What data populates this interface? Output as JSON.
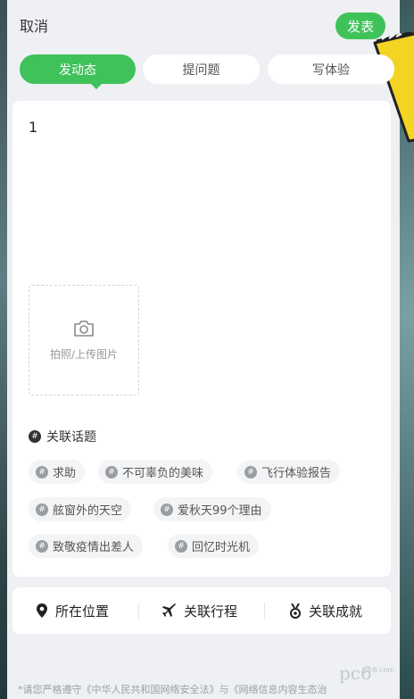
{
  "header": {
    "cancel_label": "取消",
    "publish_label": "发表"
  },
  "tabs": [
    {
      "label": "发动态",
      "active": true
    },
    {
      "label": "提问题",
      "active": false
    },
    {
      "label": "写体验",
      "active": false
    }
  ],
  "editor": {
    "text": "1"
  },
  "upload": {
    "label": "拍照/上传图片",
    "icon": "camera-icon"
  },
  "topics": {
    "heading": "关联话题",
    "items": [
      {
        "label": "求助"
      },
      {
        "label": "不可辜负的美味"
      },
      {
        "label": "飞行体验报告"
      },
      {
        "label": "舷窗外的天空"
      },
      {
        "label": "爱秋天99个理由"
      },
      {
        "label": "致敬疫情出差人"
      },
      {
        "label": "回忆时光机"
      }
    ]
  },
  "bottom_bar": [
    {
      "label": "所在位置",
      "icon": "location-pin-icon"
    },
    {
      "label": "关联行程",
      "icon": "airplane-icon"
    },
    {
      "label": "关联成就",
      "icon": "medal-icon"
    }
  ],
  "notice": "*请您严格遵守《中华人民共和国网络安全法》与《网络信息内容生态治",
  "watermark": {
    "text": "pc6",
    "sub": "pc6.com"
  },
  "colors": {
    "accent": "#3fc25a",
    "background": "#eef0f3",
    "card": "#ffffff"
  }
}
